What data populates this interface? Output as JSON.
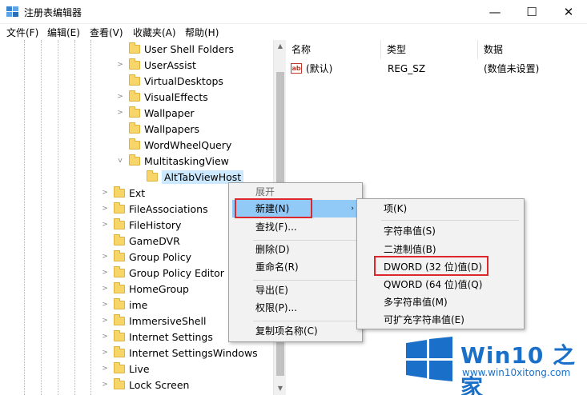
{
  "window": {
    "title": "注册表编辑器",
    "controls": {
      "minimize": "—",
      "maximize": "☐",
      "close": "✕"
    }
  },
  "menubar": [
    "文件(F)",
    "编辑(E)",
    "查看(V)",
    "收藏夹(A)",
    "帮助(H)"
  ],
  "tree": {
    "items": [
      {
        "label": "User Shell Folders",
        "expander": "",
        "selected": false
      },
      {
        "label": "UserAssist",
        "expander": ">",
        "selected": false
      },
      {
        "label": "VirtualDesktops",
        "expander": "",
        "selected": false
      },
      {
        "label": "VisualEffects",
        "expander": ">",
        "selected": false
      },
      {
        "label": "Wallpaper",
        "expander": ">",
        "selected": false
      },
      {
        "label": "Wallpapers",
        "expander": "",
        "selected": false
      },
      {
        "label": "WordWheelQuery",
        "expander": "",
        "selected": false
      },
      {
        "label": "MultitaskingView",
        "expander": "v",
        "selected": false
      },
      {
        "label": "AltTabViewHost",
        "expander": "",
        "selected": true
      },
      {
        "label": "Ext",
        "expander": ">",
        "selected": false
      },
      {
        "label": "FileAssociations",
        "expander": ">",
        "selected": false
      },
      {
        "label": "FileHistory",
        "expander": ">",
        "selected": false
      },
      {
        "label": "GameDVR",
        "expander": "",
        "selected": false
      },
      {
        "label": "Group Policy",
        "expander": ">",
        "selected": false
      },
      {
        "label": "Group Policy Editor",
        "expander": ">",
        "selected": false
      },
      {
        "label": "HomeGroup",
        "expander": ">",
        "selected": false
      },
      {
        "label": "ime",
        "expander": ">",
        "selected": false
      },
      {
        "label": "ImmersiveShell",
        "expander": ">",
        "selected": false
      },
      {
        "label": "Internet Settings",
        "expander": ">",
        "selected": false
      },
      {
        "label": "Internet SettingsWindows",
        "expander": ">",
        "selected": false
      },
      {
        "label": "Live",
        "expander": ">",
        "selected": false
      },
      {
        "label": "Lock Screen",
        "expander": ">",
        "selected": false
      }
    ]
  },
  "values_panel": {
    "columns": {
      "name": "名称",
      "type": "类型",
      "data": "数据"
    },
    "rows": [
      {
        "icon": "ab",
        "name": "(默认)",
        "type": "REG_SZ",
        "data": "(数值未设置)"
      }
    ]
  },
  "context_menu": {
    "items": {
      "expand": "展开",
      "new": "新建(N)",
      "find": "查找(F)...",
      "delete": "删除(D)",
      "rename": "重命名(R)",
      "export": "导出(E)",
      "permissions": "权限(P)...",
      "copy_key_name": "复制项名称(C)"
    },
    "submenu_arrow": "›"
  },
  "submenu": {
    "items": {
      "key": "项(K)",
      "string": "字符串值(S)",
      "binary": "二进制值(B)",
      "dword": "DWORD (32 位)值(D)",
      "qword": "QWORD (64 位)值(Q)",
      "multi_string": "多字符串值(M)",
      "expandable_string": "可扩充字符串值(E)"
    }
  },
  "watermark": {
    "brand": "Win10 之家",
    "url": "www.win10xitong.com"
  },
  "colors": {
    "highlight": "#91c9f7",
    "red_box": "#e0262d",
    "brand_blue": "#1a6fc9"
  }
}
